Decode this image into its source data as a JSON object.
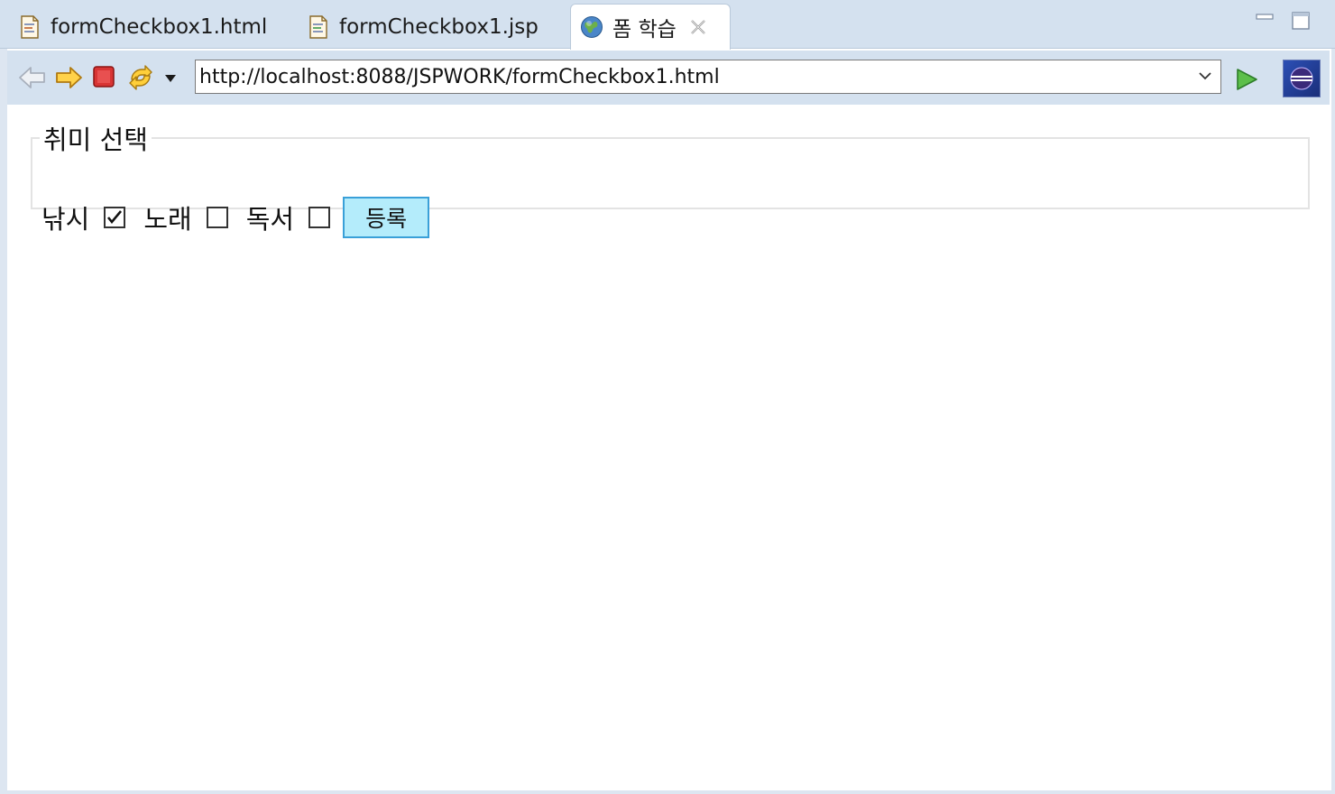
{
  "tabs": [
    {
      "label": "formCheckbox1.html",
      "icon": "html-file-icon"
    },
    {
      "label": "formCheckbox1.jsp",
      "icon": "jsp-file-icon"
    },
    {
      "label": "폼 학습",
      "icon": "globe-icon",
      "active": true
    }
  ],
  "toolbar": {
    "url": "http://localhost:8088/JSPWORK/formCheckbox1.html"
  },
  "form": {
    "legend": "취미 선택",
    "options": [
      {
        "label": "낚시",
        "checked": true
      },
      {
        "label": "노래",
        "checked": false
      },
      {
        "label": "독서",
        "checked": false
      }
    ],
    "submit_label": "등록"
  },
  "colors": {
    "chrome": "#d4e1ef",
    "button_bg": "#b4ecfb",
    "button_border": "#3aa0d8"
  }
}
